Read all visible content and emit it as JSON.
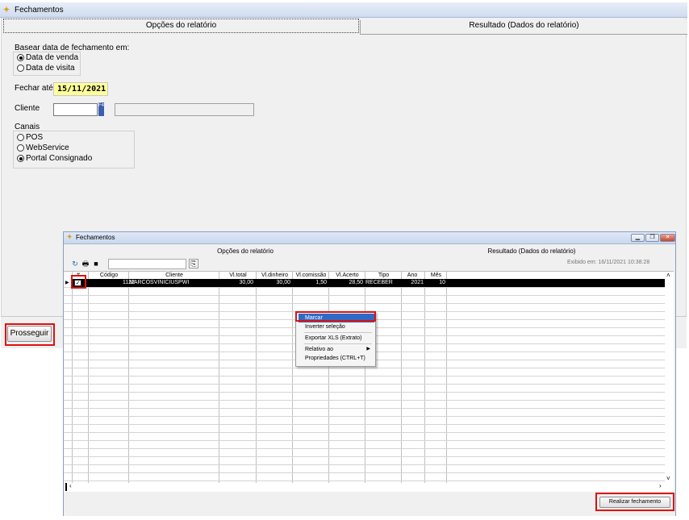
{
  "back_window": {
    "title": "Fechamentos",
    "tabs": [
      "Opções do relatório",
      "Resultado (Dados do relatório)"
    ],
    "date_basis_label": "Basear data de fechamento em:",
    "date_basis_options": [
      "Data de venda",
      "Data de visita"
    ],
    "fechar_ate_label": "Fechar até:",
    "fechar_ate_value": "15/11/2021",
    "cliente_label": "Cliente",
    "f4_label": "F4",
    "canais_label": "Canais",
    "canais_options": [
      "POS",
      "WebService",
      "Portal Consignado"
    ],
    "prosseguir_label": "Prosseguir"
  },
  "front_window": {
    "title": "Fechamentos",
    "tabs": [
      "Opções do relatório",
      "Resultado (Dados do relatório)"
    ],
    "generated_at": "Exibido em: 16/11/2021 10:38:28",
    "columns": [
      "#",
      "Código",
      "Cliente",
      "Vl.total",
      "Vl.dinheiro",
      "Vl.comissão",
      "Vl.Acerto",
      "Tipo",
      "Ano",
      "Mês"
    ],
    "rows": [
      {
        "codigo": "1122",
        "cliente": "MARCOSVINICIUSPWI",
        "vl_total": "30,00",
        "vl_dinheiro": "30,00",
        "vl_comissao": "1,50",
        "vl_acerto": "28,50",
        "tipo": "RECEBER",
        "ano": "2021",
        "mes": "10"
      }
    ],
    "realizar_label": "Realizar fechamento"
  },
  "context_menu": {
    "items": [
      "Marcar",
      "Inverter seleção",
      "Exportar XLS (Extrato)",
      "Relativo ao",
      "Propriedades (CTRL+T)"
    ]
  },
  "colors": {
    "highlight_red": "#e01010",
    "date_field_bg": "#ffff99",
    "menu_highlight": "#316ac5"
  }
}
